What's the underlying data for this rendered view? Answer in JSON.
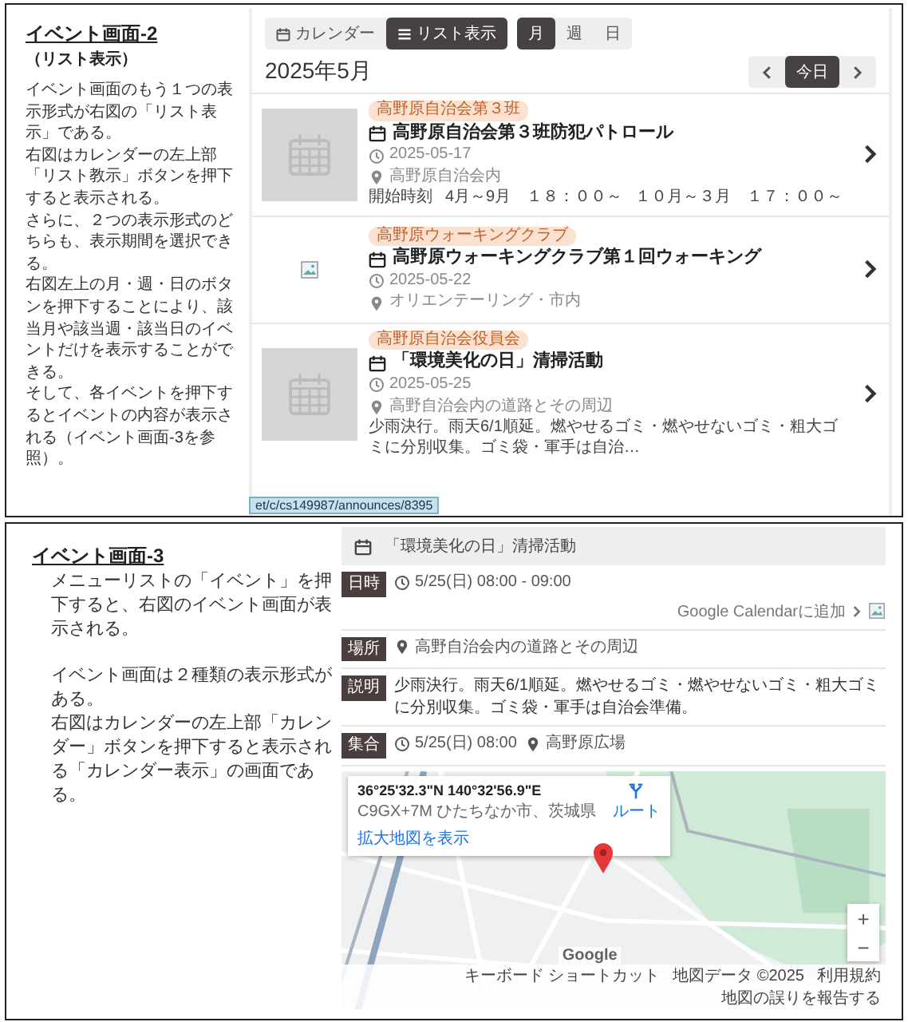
{
  "list_view_section": {
    "heading": "イベント画面-2",
    "subheading": "（リスト表示）",
    "paragraphs": [
      "イベント画面のもう１つの表示形式が右図の「リスト表示」である。",
      "右図はカレンダーの左上部「リスト教示」ボタンを押下すると表示される。",
      "さらに、２つの表示形式のどちらも、表示期間を選択できる。",
      "右図左上の月・週・日のボタンを押下することにより、該当月や該当週・該当日のイベントだけを表示することができる。",
      "そして、各イベントを押下するとイベントの内容が表示される（イベント画面-3を参照）。"
    ],
    "screenshot": {
      "view_toggle": [
        {
          "label": "カレンダー",
          "kind": "calendar",
          "selected": false
        },
        {
          "label": "リスト表示",
          "kind": "list",
          "selected": true
        }
      ],
      "range_toggle": [
        {
          "label": "月",
          "selected": true
        },
        {
          "label": "週",
          "selected": false
        },
        {
          "label": "日",
          "selected": false
        }
      ],
      "month_title": "2025年5月",
      "today_button": "今日",
      "events": [
        {
          "tag": "高野原自治会第３班",
          "title": "高野原自治会第３班防犯パトロール",
          "date": "2025-05-17",
          "location": "高野原自治会内",
          "kind": "placeholder",
          "start_times": [
            "開始時刻",
            "4月～9月　１８：００～",
            "１０月～３月　１７：００～"
          ]
        },
        {
          "tag": "高野原ウォーキングクラブ",
          "title": "高野原ウォーキングクラブ第１回ウォーキング",
          "date": "2025-05-22",
          "location": "オリエンテーリング・市内",
          "kind": "broken"
        },
        {
          "tag": "高野原自治会役員会",
          "title": "「環境美化の日」清掃活動",
          "date": "2025-05-25",
          "location": "高野自治会内の道路とその周辺",
          "description": "少雨決行。雨天6/1順延。燃やせるゴミ・燃やせないゴミ・粗大ゴミに分別収集。ゴミ袋・軍手は自治…",
          "kind": "placeholder"
        }
      ],
      "status_url": "et/c/cs149987/announces/8395"
    }
  },
  "event_detail_section": {
    "heading": "イベント画面-3",
    "paragraph_groups": [
      [
        "メニューリストの「イベント」を押下すると、右図のイベント画面が表示される。"
      ],
      [
        "イベント画面は２種類の表示形式がある。",
        "右図はカレンダーの左上部「カレンダー」ボタンを押下すると表示される「カレンダー表示」の画面である。"
      ]
    ],
    "screenshot": {
      "title": "「環境美化の日」清掃活動",
      "rows": [
        {
          "label": "日時",
          "kind": "time",
          "time": "5/25(日) 08:00 - 09:00",
          "link": "Google Calendarに追加"
        },
        {
          "label": "場所",
          "kind": "place",
          "place": "高野自治会内の道路とその周辺"
        },
        {
          "label": "説明",
          "kind": "text",
          "text": "少雨決行。雨天6/1順延。燃やせるゴミ・燃やせないゴミ・粗大ゴミに分別収集。ゴミ袋・軍手は自治会準備。"
        },
        {
          "label": "集合",
          "kind": "meeting",
          "time": "5/25(日) 08:00",
          "place": "高野原広場"
        }
      ],
      "map": {
        "coordinates": "36°25'32.3\"N 140°32'56.9\"E",
        "address": "C9GX+7M ひたちなか市、茨城県",
        "route": "ルート",
        "larger_map": "拡大地図を表示",
        "zoom_in": "+",
        "zoom_out": "−",
        "logo": "Google",
        "footer": [
          "キーボード ショートカット",
          "地図データ ©2025",
          "利用規約",
          "地図の誤りを報告する"
        ]
      }
    }
  }
}
